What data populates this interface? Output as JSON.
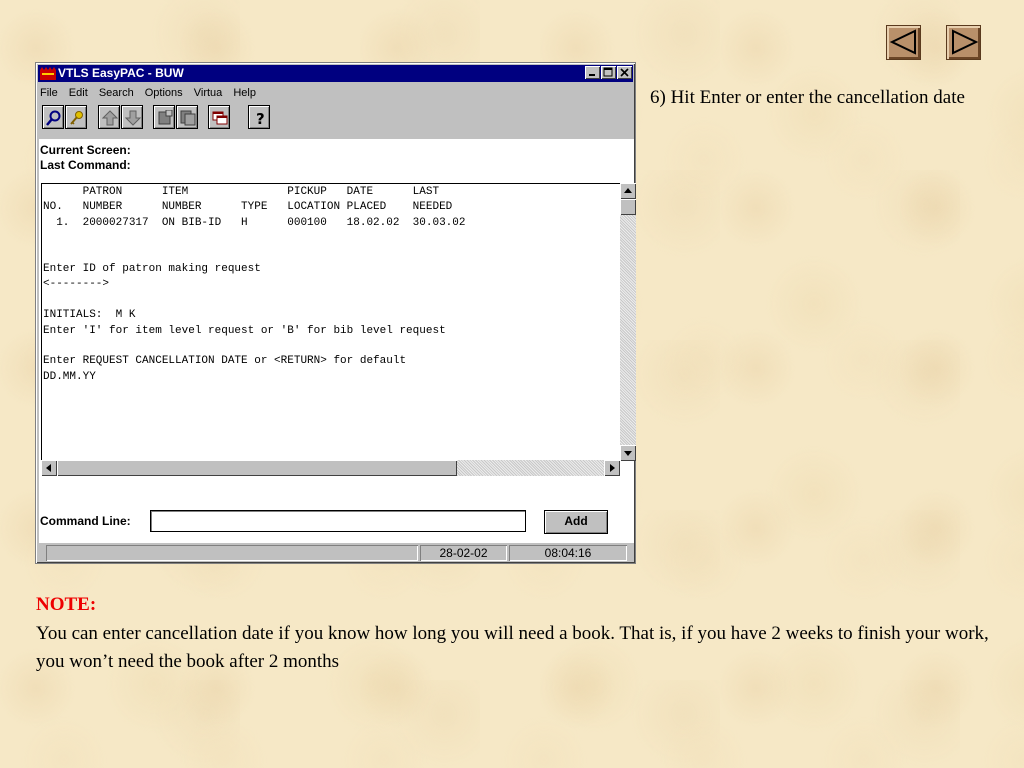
{
  "slide": {
    "instruction": "6) Hit Enter or enter the cancellation date",
    "note_title": "NOTE:",
    "note_body": "You can enter cancellation date if you know how long you will need a book. That is, if you have 2 weeks to finish your work, you won’t need the book after 2 months",
    "nav_icons": [
      "triangle-left-icon",
      "triangle-right-icon"
    ]
  },
  "window": {
    "title": "VTLS EasyPAC - BUW",
    "controls": [
      "minimize",
      "maximize",
      "close"
    ],
    "menu": [
      "File",
      "Edit",
      "Search",
      "Options",
      "Virtua",
      "Help"
    ],
    "toolbar_icons": [
      "search-icon",
      "key-icon",
      "arrow-up-icon",
      "arrow-down-icon",
      "document-icon",
      "copy-icon",
      "windows-icon",
      "help-icon"
    ],
    "current_screen_label": "Current Screen:",
    "last_command_label": "Last Command:",
    "terminal_lines": [
      "      PATRON      ITEM               PICKUP   DATE      LAST",
      "NO.   NUMBER      NUMBER      TYPE   LOCATION PLACED    NEEDED",
      "  1.  2000027317  ON BIB-ID   H      000100   18.02.02  30.03.02",
      "",
      "",
      "Enter ID of patron making request",
      "<-------->",
      "",
      "INITIALS:  M K",
      "Enter 'I' for item level request or 'B' for bib level request",
      "",
      "Enter REQUEST CANCELLATION DATE or <RETURN> for default",
      "DD.MM.YY"
    ],
    "command_line_label": "Command Line:",
    "command_value": "",
    "add_button": "Add",
    "status_date": "28-02-02",
    "status_time": "08:04:16"
  },
  "colors": {
    "titlebar": "#000080",
    "note_title": "#ee0000",
    "nav_button": "#b9906a"
  }
}
